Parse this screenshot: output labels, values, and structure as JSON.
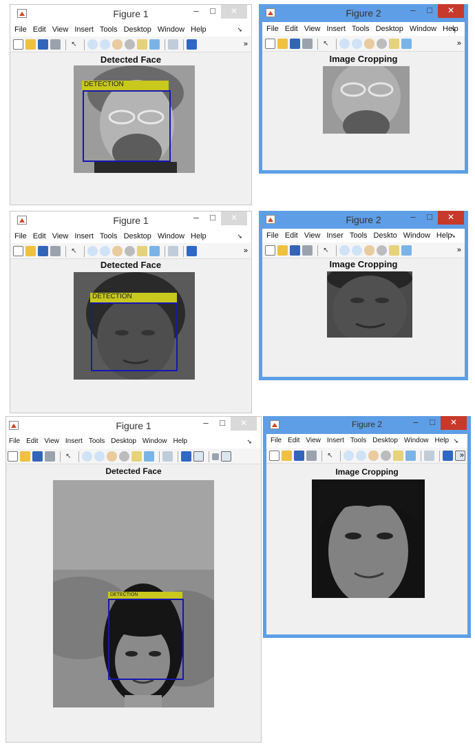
{
  "fig1": {
    "title": "Figure 1",
    "menus": [
      "File",
      "Edit",
      "View",
      "Insert",
      "Tools",
      "Desktop",
      "Window",
      "Help"
    ],
    "axes_title": "Detected Face",
    "detection_label": "DETECTION"
  },
  "fig2": {
    "title": "Figure 2",
    "menus": [
      "File",
      "Edit",
      "View",
      "Insert",
      "Tools",
      "Desktop",
      "Window",
      "Help"
    ],
    "axes_title": "Image Cropping"
  },
  "row2": {
    "fig1_menus": [
      "File",
      "Edit",
      "View",
      "Insert",
      "Tools",
      "Desktop",
      "Window",
      "Help"
    ],
    "fig2_menus": [
      "File",
      "Edit",
      "View",
      "Inser",
      "Tools",
      "Deskto",
      "Window",
      "Help"
    ]
  },
  "row3": {
    "detection_label": "DETECTION"
  },
  "icons": {
    "minimize": "–",
    "maximize": "□",
    "close": "✕",
    "pointer": "↖",
    "more": "»",
    "menu_overflow": "➘"
  },
  "colors": {
    "active_frame": "#5e9ee6",
    "close_button": "#c7392b",
    "bbox": "#1616b4",
    "detection_label_bg": "#c8c81e"
  }
}
